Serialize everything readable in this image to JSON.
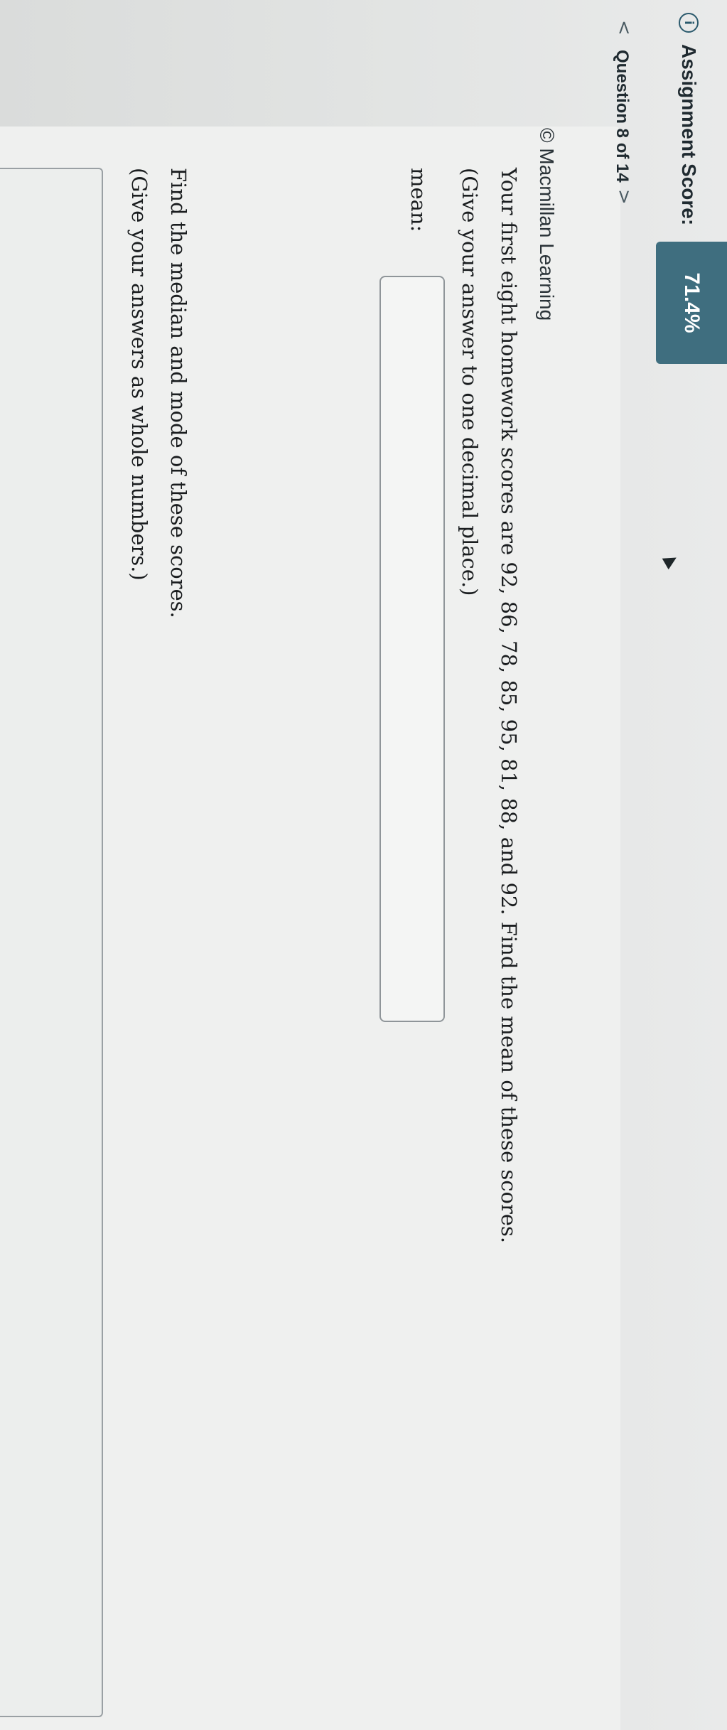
{
  "header": {
    "score_label": "Assignment Score:",
    "score_value": "71.4%",
    "info_icon": "info-icon"
  },
  "navigation": {
    "prev": "<",
    "counter": "Question 8 of 14",
    "next": ">"
  },
  "copyright": "© Macmillan Learning",
  "question": {
    "prompt": "Your first eight homework scores are 92, 86, 78, 85, 95, 81, 88, and 92. Find the mean of these scores.",
    "instruction": "(Give your answer to one decimal place.)",
    "mean_label": "mean:",
    "mean_value": ""
  },
  "question2": {
    "prompt": "Find the median and mode of these scores.",
    "instruction": "(Give your answers as whole numbers.)"
  },
  "colors": {
    "accent": "#3f6e7f",
    "text": "#1a1d1f"
  }
}
